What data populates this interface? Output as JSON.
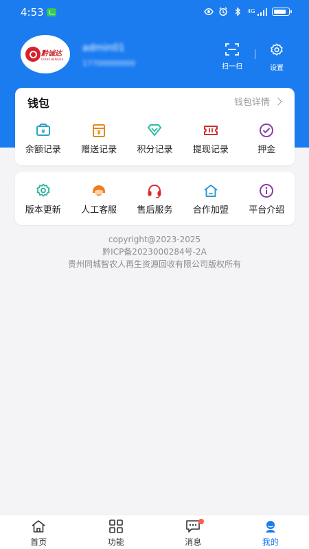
{
  "status_bar": {
    "time": "4:53",
    "network": "4G"
  },
  "profile": {
    "brand_name": "黔诚达",
    "brand_sub": "QIANCHENGDA",
    "username": "admin01",
    "user_id": "17700000000"
  },
  "header_actions": {
    "scan_label": "扫一扫",
    "settings_label": "设置"
  },
  "wallet": {
    "title": "钱包",
    "detail_link": "钱包详情",
    "items": [
      {
        "label": "余额记录",
        "icon": "balance-icon",
        "color": "#2ba4c6"
      },
      {
        "label": "赠送记录",
        "icon": "gift-record-icon",
        "color": "#e58a1c"
      },
      {
        "label": "积分记录",
        "icon": "points-icon",
        "color": "#2dbba4"
      },
      {
        "label": "提现记录",
        "icon": "withdraw-icon",
        "color": "#d02f2f"
      },
      {
        "label": "押金",
        "icon": "deposit-icon",
        "color": "#8a3ea8"
      }
    ]
  },
  "services": {
    "items": [
      {
        "label": "版本更新",
        "icon": "gear-icon",
        "color": "#2ab3a0"
      },
      {
        "label": "人工客服",
        "icon": "agent-icon",
        "color": "#f07d20"
      },
      {
        "label": "售后服务",
        "icon": "headset-icon",
        "color": "#d92b2b"
      },
      {
        "label": "合作加盟",
        "icon": "home-icon",
        "color": "#2d9bd6"
      },
      {
        "label": "平台介绍",
        "icon": "info-icon",
        "color": "#8a3ea8"
      }
    ]
  },
  "footer": {
    "copyright": "copyright@2023-2025",
    "icp": "黔ICP备2023000284号-2A",
    "company": "贵州同城智农人再生资源回收有限公司版权所有"
  },
  "bottom_nav": {
    "items": [
      {
        "label": "首页",
        "active": false
      },
      {
        "label": "功能",
        "active": false
      },
      {
        "label": "消息",
        "active": false,
        "has_badge": true
      },
      {
        "label": "我的",
        "active": true
      }
    ]
  },
  "colors": {
    "primary": "#1b7cf0",
    "background": "#f4f4f6",
    "badge": "#ff5a4e"
  }
}
